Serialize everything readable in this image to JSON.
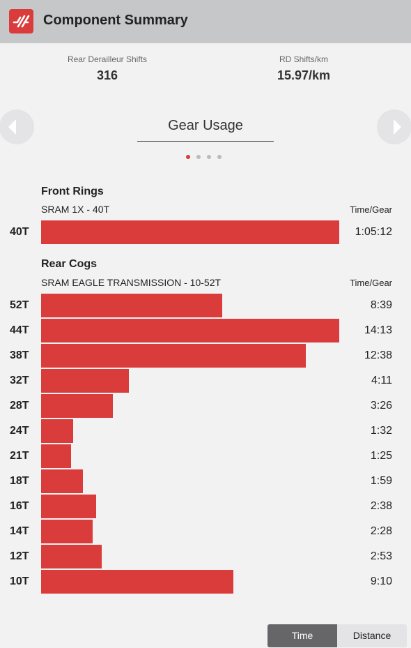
{
  "header": {
    "title": "Component Summary",
    "logo_icon": "srm-logo-icon"
  },
  "stats": [
    {
      "label": "Rear Derailleur Shifts",
      "value": "316"
    },
    {
      "label": "RD Shifts/km",
      "value": "15.97/km"
    }
  ],
  "carousel": {
    "title": "Gear Usage",
    "pages": 4,
    "active_page": 0,
    "prev_icon": "arrow-left-icon",
    "next_icon": "arrow-right-icon"
  },
  "colors": {
    "bar": "#d93c3a",
    "dot_active": "#d93c3a",
    "dot_inactive": "#bbbbbe"
  },
  "front": {
    "title": "Front Rings",
    "subtitle": "SRAM 1X - 40T",
    "column_header": "Time/Gear",
    "gears": [
      {
        "label": "40T",
        "time": "1:05:12",
        "seconds": 3912
      }
    ]
  },
  "rear": {
    "title": "Rear Cogs",
    "subtitle": "SRAM EAGLE TRANSMISSION - 10-52T",
    "column_header": "Time/Gear",
    "gears": [
      {
        "label": "52T",
        "time": "8:39",
        "seconds": 519
      },
      {
        "label": "44T",
        "time": "14:13",
        "seconds": 853
      },
      {
        "label": "38T",
        "time": "12:38",
        "seconds": 758
      },
      {
        "label": "32T",
        "time": "4:11",
        "seconds": 251
      },
      {
        "label": "28T",
        "time": "3:26",
        "seconds": 206
      },
      {
        "label": "24T",
        "time": "1:32",
        "seconds": 92
      },
      {
        "label": "21T",
        "time": "1:25",
        "seconds": 85
      },
      {
        "label": "18T",
        "time": "1:59",
        "seconds": 119
      },
      {
        "label": "16T",
        "time": "2:38",
        "seconds": 158
      },
      {
        "label": "14T",
        "time": "2:28",
        "seconds": 148
      },
      {
        "label": "12T",
        "time": "2:53",
        "seconds": 173
      },
      {
        "label": "10T",
        "time": "9:10",
        "seconds": 550
      }
    ]
  },
  "toggle": {
    "options": [
      "Time",
      "Distance"
    ],
    "selected": "Time"
  }
}
